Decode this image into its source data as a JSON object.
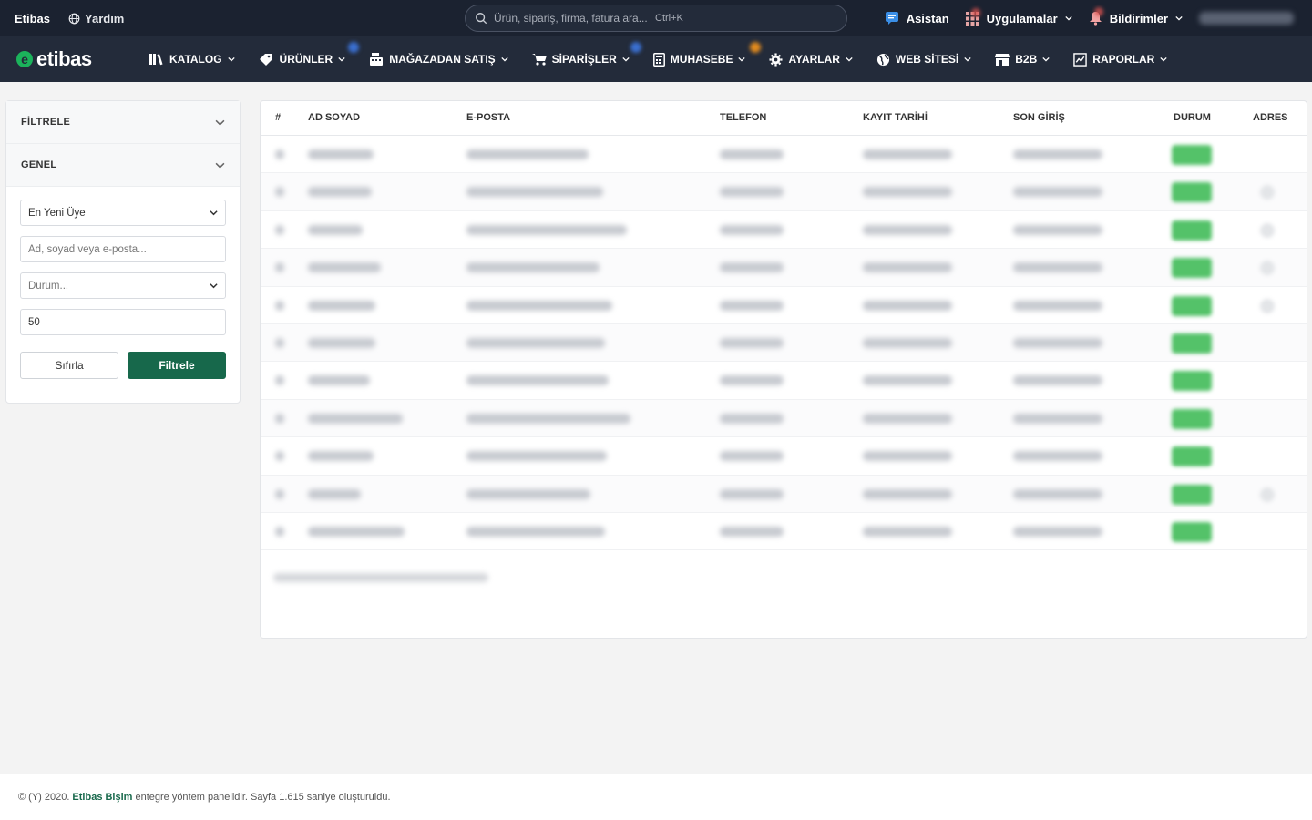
{
  "topbar": {
    "brand": "Etibas",
    "help_label": "Yardım",
    "search_placeholder": "Ürün, sipariş, firma, fatura ara...",
    "search_shortcut": "Ctrl+K",
    "assistant_label": "Asistan",
    "apps_label": "Uygulamalar",
    "notifications_label": "Bildirimler"
  },
  "navbar": {
    "logo_text": "etibas",
    "items": [
      {
        "label": "KATALOG"
      },
      {
        "label": "ÜRÜNLER"
      },
      {
        "label": "MAĞAZADAN SATIŞ"
      },
      {
        "label": "SİPARİŞLER"
      },
      {
        "label": "MUHASEBE"
      },
      {
        "label": "AYARLAR"
      },
      {
        "label": "WEB SİTESİ"
      },
      {
        "label": "B2B"
      },
      {
        "label": "RAPORLAR"
      }
    ]
  },
  "filters": {
    "filter_header": "FİLTRELE",
    "general_header": "GENEL",
    "sort_value": "En Yeni Üye",
    "search_placeholder": "Ad, soyad veya e-posta...",
    "status_placeholder": "Durum...",
    "limit_value": "50",
    "reset_label": "Sıfırla",
    "filter_label": "Filtrele"
  },
  "table": {
    "columns": [
      "#",
      "AD SOYAD",
      "E-POSTA",
      "TELEFON",
      "KAYIT TARİHİ",
      "SON GİRİŞ",
      "DURUM",
      "ADRES"
    ]
  },
  "footer": {
    "prefix": "© (Y) 2020.",
    "link": "Etibas Bişim",
    "suffix": "entegre yöntem panelidir. Sayfa 1.615 saniye oluşturuldu."
  },
  "colors": {
    "topbar_bg": "#1b2230",
    "navbar_bg": "#232b3a",
    "accent_green": "#17684b",
    "status_green": "#54c269"
  }
}
